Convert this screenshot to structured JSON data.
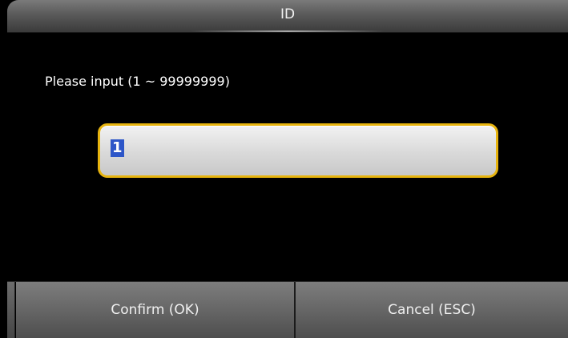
{
  "window": {
    "title": "ID"
  },
  "form": {
    "prompt": "Please input (1 ~ 99999999)",
    "input_value": "1"
  },
  "buttons": {
    "confirm_label": "Confirm (OK)",
    "cancel_label": "Cancel (ESC)"
  },
  "colors": {
    "accent_border": "#e7b40f",
    "selection": "#2d56c8",
    "background": "#000000"
  }
}
